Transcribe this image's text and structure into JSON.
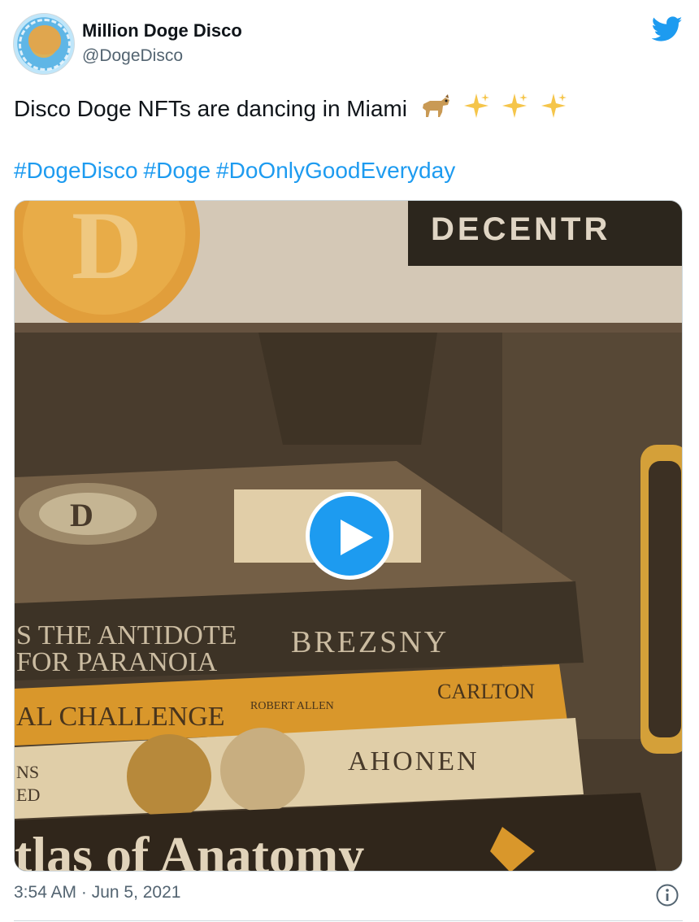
{
  "tweet": {
    "author_name": "Million Doge Disco",
    "author_handle": "@DogeDisco",
    "text": "Disco Doge NFTs are dancing in Miami",
    "emojis": [
      "dog-emoji",
      "sparkles-emoji",
      "sparkles-emoji",
      "sparkles-emoji"
    ],
    "hashtags": [
      "#DogeDisco",
      "#Doge",
      "#DoOnlyGoodEveryday"
    ],
    "timestamp": "3:54 AM · Jun 5, 2021"
  },
  "media": {
    "type": "video",
    "book_spines": [
      {
        "line1": "S THE ANTIDOTE",
        "line2": "FOR PARANOIA",
        "author": "BREZSNY"
      },
      {
        "title": "AL CHALLENGE",
        "subtitle": "ROBERT ALLEN",
        "author": "CARLTON"
      },
      {
        "line1": "NS",
        "line2": "ED",
        "author": "AHONEN"
      },
      {
        "title": "tlas of Anatomy"
      }
    ],
    "poster_text": "DECENTR"
  },
  "colors": {
    "accent": "#1d9bf0",
    "text_primary": "#0f1419",
    "text_secondary": "#536471"
  }
}
